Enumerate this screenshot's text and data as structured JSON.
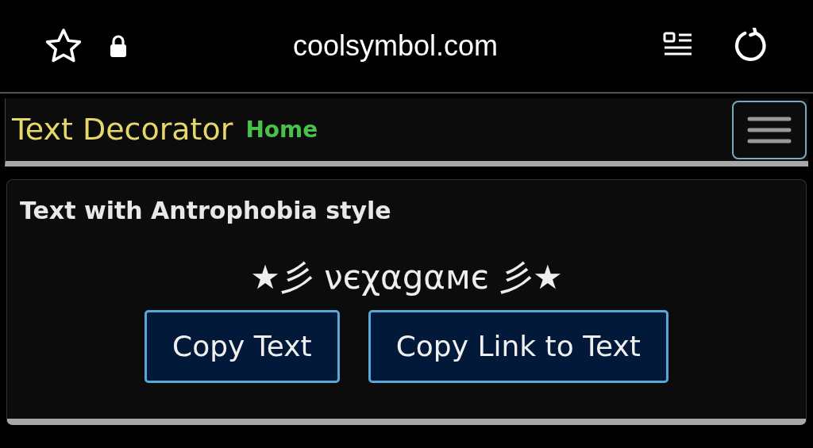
{
  "browser": {
    "url": "coolsymbol.com"
  },
  "navbar": {
    "brand": "Text Decorator",
    "link": "Home"
  },
  "card": {
    "title": "Text with Antrophobia style",
    "decorated_text": "★彡 νєχαgαмє 彡★",
    "buttons": [
      "Copy Text",
      "Copy Link to Text"
    ]
  }
}
